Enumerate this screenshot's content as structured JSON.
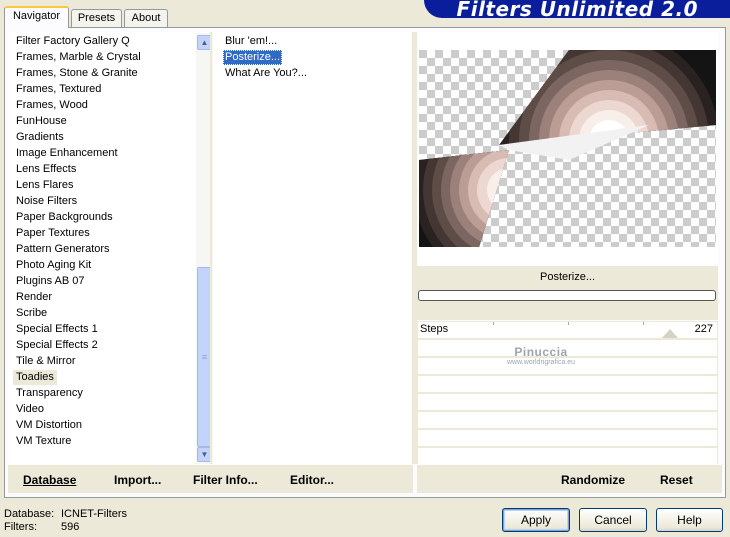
{
  "window_title": "Filters Unlimited 2.0",
  "tabs": [
    {
      "label": "Navigator",
      "active": true
    },
    {
      "label": "Presets",
      "active": false
    },
    {
      "label": "About",
      "active": false
    }
  ],
  "categories": [
    "Filter Factory Gallery Q",
    "Frames, Marble & Crystal",
    "Frames, Stone & Granite",
    "Frames, Textured",
    "Frames, Wood",
    "FunHouse",
    "Gradients",
    "Image Enhancement",
    "Lens Effects",
    "Lens Flares",
    "Noise Filters",
    "Paper Backgrounds",
    "Paper Textures",
    "Pattern Generators",
    "Photo Aging Kit",
    "Plugins AB 07",
    "Render",
    "Scribe",
    "Special Effects 1",
    "Special Effects 2",
    "Tile & Mirror",
    "Toadies",
    "Transparency",
    "Video",
    "VM Distortion",
    "VM Texture"
  ],
  "selected_category": "Toadies",
  "filters": [
    "Blur 'em!...",
    "Posterize...",
    "What Are You?..."
  ],
  "selected_filter": "Posterize...",
  "current_filter_label": "Posterize...",
  "progress": 0,
  "parameters": [
    {
      "label": "Steps",
      "value": "227",
      "max": 255
    }
  ],
  "watermark": {
    "line1": "Pinuccia",
    "line2": "www.worldrigrafica.eu"
  },
  "bottom_links": {
    "database": "Database",
    "import": "Import...",
    "filter_info": "Filter Info...",
    "editor": "Editor...",
    "randomize": "Randomize",
    "reset": "Reset"
  },
  "status": {
    "database_label": "Database:",
    "database_value": "ICNET-Filters",
    "filters_label": "Filters:",
    "filters_value": "596"
  },
  "buttons": {
    "apply": "Apply",
    "cancel": "Cancel",
    "help": "Help"
  },
  "colors": {
    "banner": "#0a1e9c",
    "selection": "#316ac5",
    "scroll": "#c4d3fc"
  }
}
